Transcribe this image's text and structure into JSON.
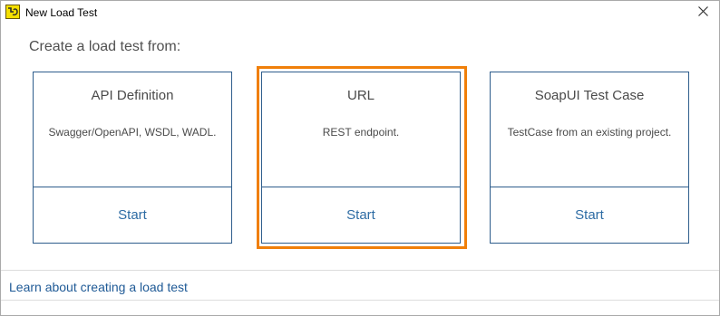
{
  "window": {
    "title": "New Load Test",
    "close_glyph": "✕"
  },
  "heading": "Create a load test from:",
  "cards": [
    {
      "title": "API Definition",
      "description": "Swagger/OpenAPI, WSDL, WADL.",
      "start_label": "Start"
    },
    {
      "title": "URL",
      "description": "REST endpoint.",
      "start_label": "Start",
      "selected": true
    },
    {
      "title": "SoapUI Test Case",
      "description": "TestCase from an existing project.",
      "start_label": "Start"
    }
  ],
  "footer": {
    "link_text": "Learn about creating a load test"
  },
  "colors": {
    "accent_highlight": "#f07f09",
    "card_border": "#2e5d8c",
    "link": "#2e6ca4",
    "app_icon_bg": "#f5e000"
  },
  "icons": {
    "app": "loadui-app-icon",
    "close": "close-icon"
  }
}
